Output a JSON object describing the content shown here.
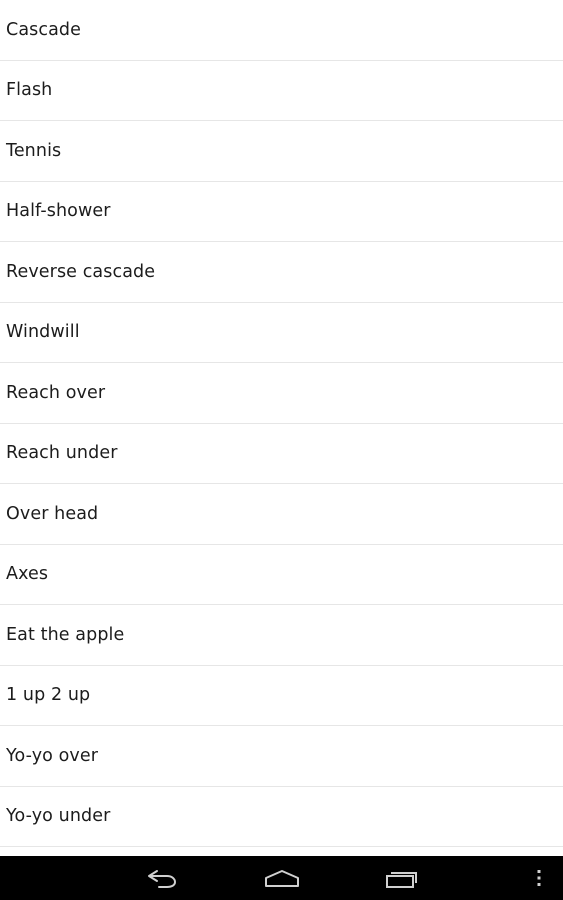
{
  "list": {
    "items": [
      {
        "label": "Cascade"
      },
      {
        "label": "Flash"
      },
      {
        "label": "Tennis"
      },
      {
        "label": "Half-shower"
      },
      {
        "label": "Reverse cascade"
      },
      {
        "label": "Windwill"
      },
      {
        "label": "Reach over"
      },
      {
        "label": "Reach under"
      },
      {
        "label": "Over head"
      },
      {
        "label": "Axes"
      },
      {
        "label": "Eat the apple"
      },
      {
        "label": "1 up 2 up"
      },
      {
        "label": "Yo-yo over"
      },
      {
        "label": "Yo-yo under"
      }
    ]
  },
  "navbar": {
    "icons": {
      "back": "back-icon",
      "home": "home-icon",
      "recents": "recent-apps-icon",
      "menu": "overflow-menu-icon"
    }
  },
  "colors": {
    "background": "#ffffff",
    "text": "#1c1c1c",
    "divider": "#e6e6e6",
    "navbar": "#000000",
    "nav_icon": "#d0d0d0"
  }
}
